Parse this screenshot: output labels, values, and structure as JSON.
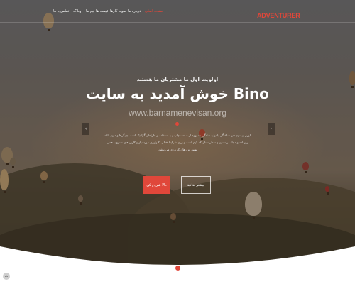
{
  "header": {
    "logo": "ADVENTURER",
    "menu": [
      {
        "label": "صفحه اصلی",
        "active": true
      },
      {
        "label": "درباره ما",
        "active": false
      },
      {
        "label": "نمونه کارها",
        "active": false
      },
      {
        "label": "قیمت ها",
        "active": false
      },
      {
        "label": "تیم ما",
        "active": false
      },
      {
        "label": "وبلاگ",
        "active": false
      },
      {
        "label": "تماس با ما",
        "active": false
      }
    ]
  },
  "hero": {
    "tagline": "اولویت اول ما مشتریان ما هستند",
    "title": "Bino خوش آمدید به سایت",
    "watermark": "www.barnamenevisan.org",
    "description": "لورم ایپسوم متن ساختگی با تولید سادگی نامفهوم از صنعت چاپ و با استفاده از طراحان گرافیک است. چاپگرها و متون بلکه روزنامه و مجله در ستون و سطرآنچنان که لازم است و برای شرایط فعلی تکنولوژی مورد نیاز و کاربردهای متنوع با هدف بهبود ابزارهای کاربردی می باشد.",
    "primary_button": "حالا شروع کن",
    "secondary_button": "بیشتر بدانید",
    "prev_arrow": "‹",
    "next_arrow": "›"
  },
  "colors": {
    "accent": "#e0473a",
    "text": "#ffffff"
  },
  "icons": {
    "scroll_down": "chevron-down-icon",
    "corner": "up-icon"
  }
}
